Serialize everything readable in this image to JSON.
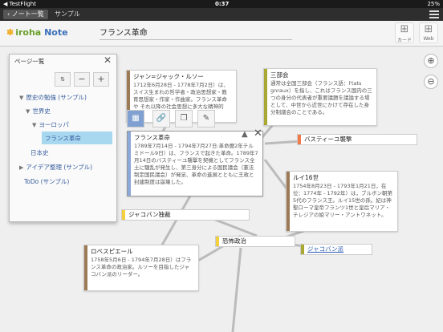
{
  "status_bar": {
    "carrier": "◀ TestFlight",
    "time": "0:37",
    "battery": "25%"
  },
  "nav": {
    "back_label": "ノート一覧",
    "title": "サンプル"
  },
  "header": {
    "logo_text": "iroha",
    "logo_note": "Note",
    "title_value": "フランス革命",
    "card_button_label": "カード",
    "web_button_label": "Web"
  },
  "pages_panel": {
    "title": "ページ一覧",
    "tree": [
      {
        "label": "歴史の勉強 (サンプル)",
        "arrow": "▼"
      },
      {
        "label": "世界史",
        "arrow": "▼"
      },
      {
        "label": "ヨーロッパ",
        "arrow": "▼"
      },
      {
        "label": "フランス革命",
        "arrow": ""
      },
      {
        "label": "日本史",
        "arrow": ""
      },
      {
        "label": "アイデア整理 (サンプル)",
        "arrow": "▶"
      },
      {
        "label": "ToDo (サンプル)",
        "arrow": ""
      }
    ]
  },
  "cards": {
    "rousseau": {
      "title": "ジャン=ジャック・ルソー",
      "body": "1712年6月28日 - 1778年7月2日）は、スイス生まれの哲学者・政治思想家・教育思想家・作家・作曲家。フランス革命や それ以降の社会思想に多大な精神的"
    },
    "sanbukai": {
      "title": "三部会",
      "body": "通常は全国三部会（フランス語：l'tats gnraux）を指し、これはフランス国内の三つの身分の代表者が重要議題を議論する場として、中世から近世にかけて存在した身分制議会のことである。"
    },
    "revolution": {
      "title": "フランス革命",
      "body": "1789年7月14日 - 1794年7月27日:革命暦2年テルミドール9日）は、フランスで起きた革命。1789年7月14日のバスティーユ襲撃を契機としてフランス全土に騒乱が発生し、第三身分による国民議会（憲法制定国民議会）が発足、革命の進展とともに王政と封建制度は崩壊した。"
    },
    "louis": {
      "title": "ルイ16世",
      "body": "1754年8月23日 - 1793年1月21日，在位：1774年 - 1792年）は，ブルボン朝第5代のフランス王。ルイ15世の孫。妃は神聖ローマ皇帝フランツ1世と皇后マリア・テレジアの娘マリー・アントワネット。"
    },
    "robespierre": {
      "title": "ロベスピエール",
      "body": "1758年5月6日 - 1794年7月28日）はフランス革命の政治家。ルソーを目指したジャコバン派のリーダー。"
    }
  },
  "labels": {
    "bastille": "バスティーユ襲撃",
    "jacobin_dictatorship": "ジャコバン独裁",
    "reign_of_terror": "恐怖政治",
    "jacobins": "ジャコバン派"
  },
  "colors": {
    "brown": "#9c7a55",
    "olive": "#a8a832",
    "blue": "#8aa8d8",
    "orange": "#f07a4a",
    "yellow": "#f4d03f"
  }
}
